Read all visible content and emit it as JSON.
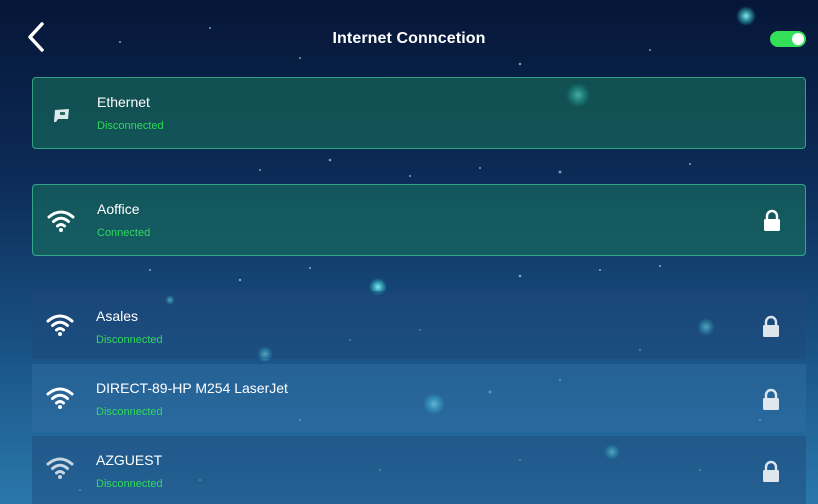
{
  "header": {
    "title": "Internet Conncetion",
    "wifi_enabled": true
  },
  "networks": [
    {
      "name": "Ethernet",
      "status": "Disconnected",
      "icon": "ethernet-icon",
      "secured": false
    },
    {
      "name": "Aoffice",
      "status": "Connected",
      "icon": "wifi-icon",
      "secured": true
    },
    {
      "name": "Asales",
      "status": "Disconnected",
      "icon": "wifi-icon",
      "secured": true
    },
    {
      "name": "DIRECT-89-HP M254 LaserJet",
      "status": "Disconnected",
      "icon": "wifi-icon",
      "secured": true
    },
    {
      "name": "AZGUEST",
      "status": "Disconnected",
      "icon": "wifi-icon",
      "secured": true
    }
  ],
  "colors": {
    "status_text": "#2fd95a",
    "toggle_on": "#34e05a",
    "card_border": "#50e6aa"
  }
}
